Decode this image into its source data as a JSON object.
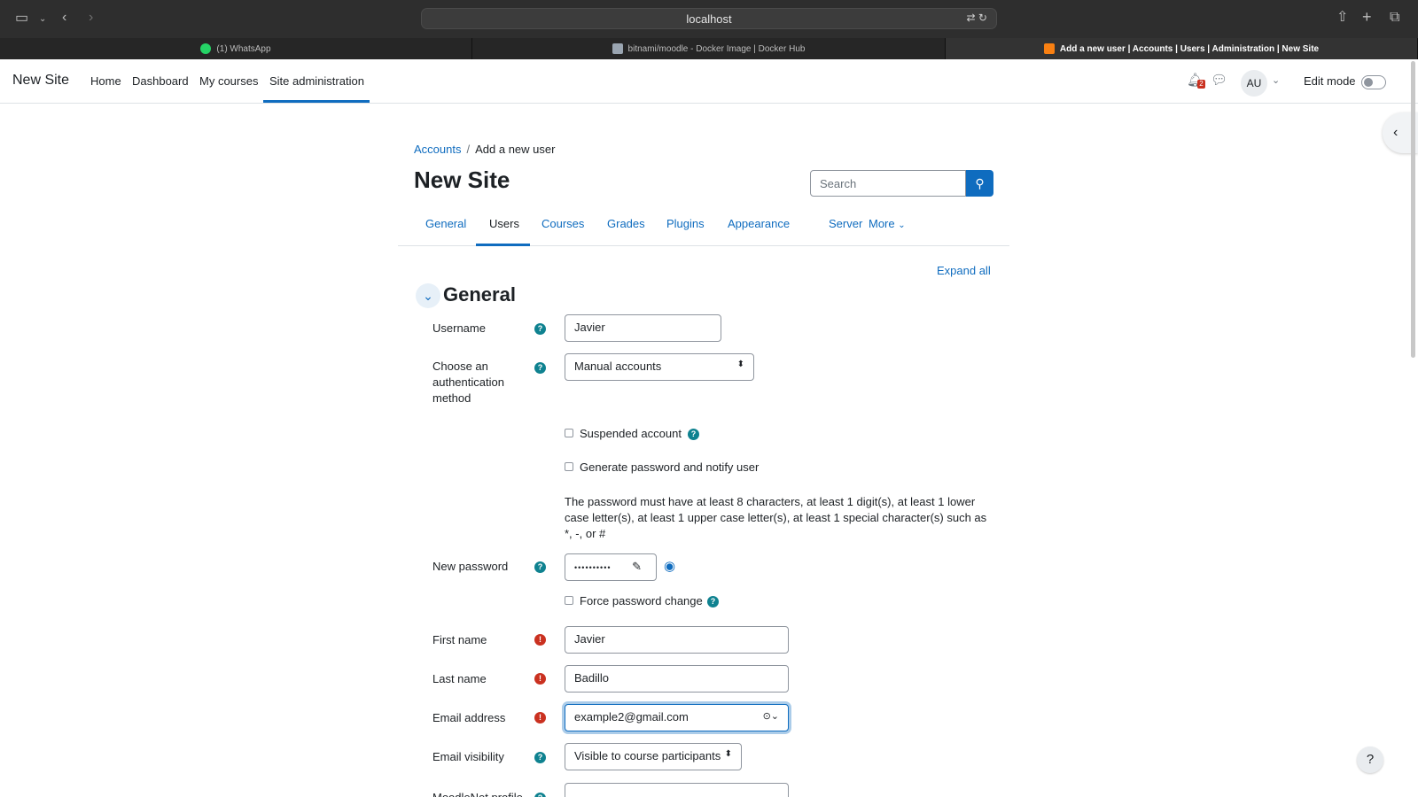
{
  "browser": {
    "url": "localhost",
    "tabs": [
      {
        "label": "(1) WhatsApp",
        "favicon": "whatsapp-icon"
      },
      {
        "label": "bitnami/moodle - Docker Image | Docker Hub",
        "favicon": "docker-icon"
      },
      {
        "label": "Add a new user | Accounts | Users | Administration | New Site",
        "favicon": "moodle-icon"
      }
    ]
  },
  "navbar": {
    "brand": "New Site",
    "links": [
      "Home",
      "Dashboard",
      "My courses",
      "Site administration"
    ],
    "avatar_initials": "AU",
    "notification_count": "2",
    "edit_mode_label": "Edit mode"
  },
  "breadcrumb": {
    "parent": "Accounts",
    "current": "Add a new user"
  },
  "page_title": "New Site",
  "search": {
    "placeholder": "Search"
  },
  "admin_tabs": [
    "General",
    "Users",
    "Courses",
    "Grades",
    "Plugins",
    "Appearance",
    "Server",
    "More"
  ],
  "expand_all": "Expand all",
  "section_title": "General",
  "form": {
    "username_label": "Username",
    "username_value": "Javier",
    "auth_label": "Choose an authentication method",
    "auth_value": "Manual accounts",
    "suspended_label": "Suspended account",
    "generate_pw_label": "Generate password and notify user",
    "password_note": "The password must have at least 8 characters, at least 1 digit(s), at least 1 lower case letter(s), at least 1 upper case letter(s), at least 1 special character(s) such as *, -, or #",
    "new_password_label": "New password",
    "new_password_value": "••••••••••",
    "force_change_label": "Force password change",
    "first_name_label": "First name",
    "first_name_value": "Javier",
    "last_name_label": "Last name",
    "last_name_value": "Badillo",
    "email_label": "Email address",
    "email_value": "example2@gmail.com",
    "email_visibility_label": "Email visibility",
    "email_visibility_value": "Visible to course participants",
    "moodlenet_label": "MoodleNet profile"
  },
  "colors": {
    "accent": "#0f6cbf",
    "help": "#0f8290",
    "required": "#ca3120"
  }
}
